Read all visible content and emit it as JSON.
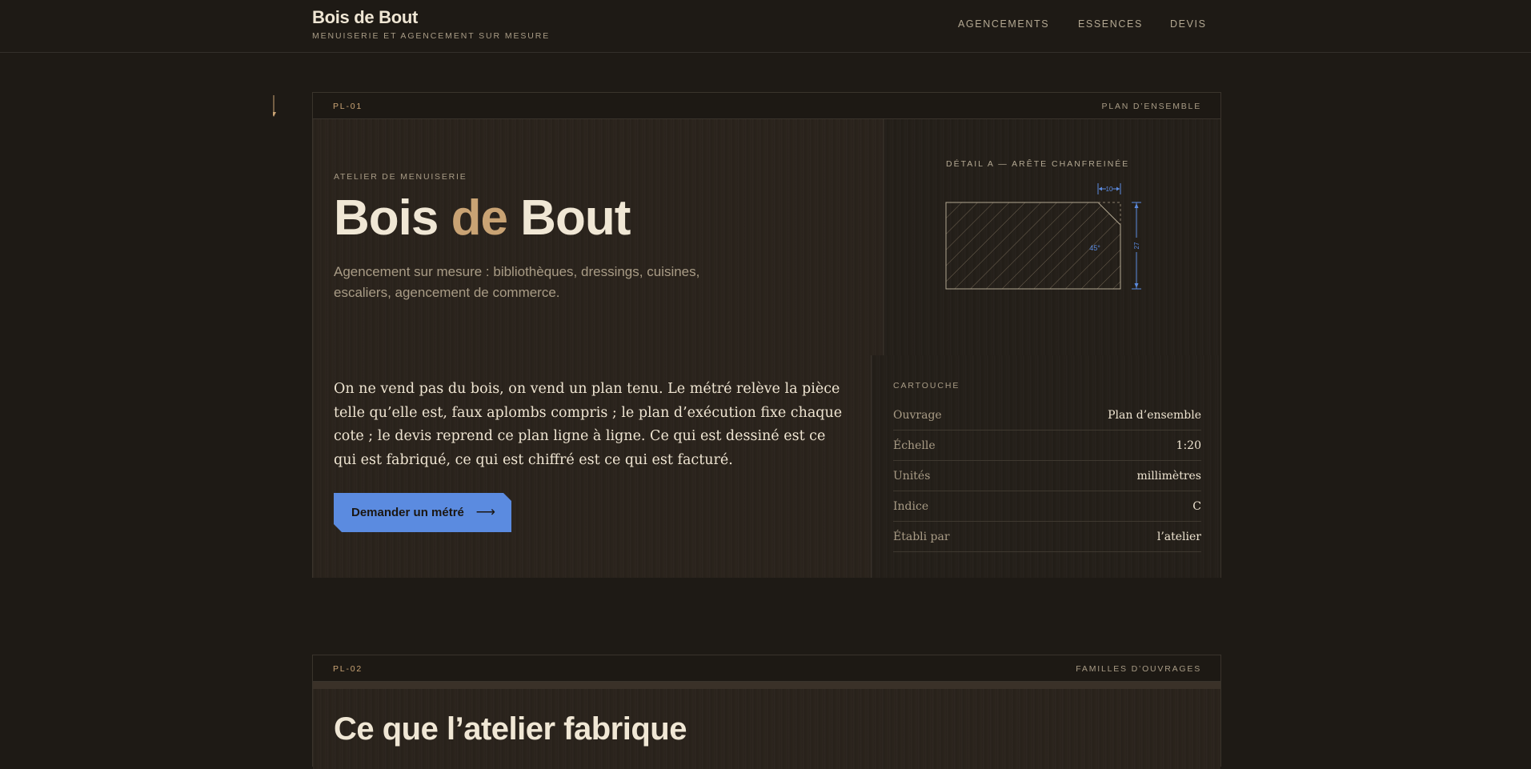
{
  "header": {
    "brand_title": "Bois de Bout",
    "brand_subtitle": "MENUISERIE ET AGENCEMENT SUR MESURE",
    "nav": [
      "AGENCEMENTS",
      "ESSENCES",
      "DEVIS"
    ]
  },
  "plate1": {
    "id": "PL-01",
    "label": "PLAN D’ENSEMBLE",
    "eyebrow": "ATELIER DE MENUISERIE",
    "title_part1": "Bois ",
    "title_accent": "de",
    "title_part2": " Bout",
    "subtitle": "Agencement sur mesure : bibliothèques, dressings, cuisines, escaliers, agencement de commerce.",
    "lead": "On ne vend pas du bois, on vend un plan tenu. Le métré relève la pièce telle qu’elle est, faux aplombs compris ; le plan d’exécution fixe chaque cote ; le devis reprend ce plan ligne à ligne. Ce qui est dessiné est ce qui est fabriqué, ce qui est chiffré est ce qui est facturé.",
    "cta_label": "Demander un métré",
    "cta_arrow": "⟶",
    "detail": {
      "title": "DÉTAIL A — ARÊTE CHANFREINÉE",
      "dim_top": "10",
      "dim_right": "27",
      "angle": "45°"
    },
    "cartouche": {
      "title": "CARTOUCHE",
      "rows": [
        {
          "key": "Ouvrage",
          "value": "Plan d’ensemble"
        },
        {
          "key": "Échelle",
          "value": "1:20"
        },
        {
          "key": "Unités",
          "value": "millimètres"
        },
        {
          "key": "Indice",
          "value": "C"
        },
        {
          "key": "Établi par",
          "value": "l’atelier"
        }
      ]
    }
  },
  "plate2": {
    "id": "PL-02",
    "label": "FAMILLES D’OUVRAGES",
    "title": "Ce que l’atelier fabrique"
  },
  "colors": {
    "background": "#1e1a15",
    "accent_wood": "#c9a374",
    "accent_blue": "#5b8be0",
    "text": "#efe5d2",
    "muted": "#a99c86"
  }
}
